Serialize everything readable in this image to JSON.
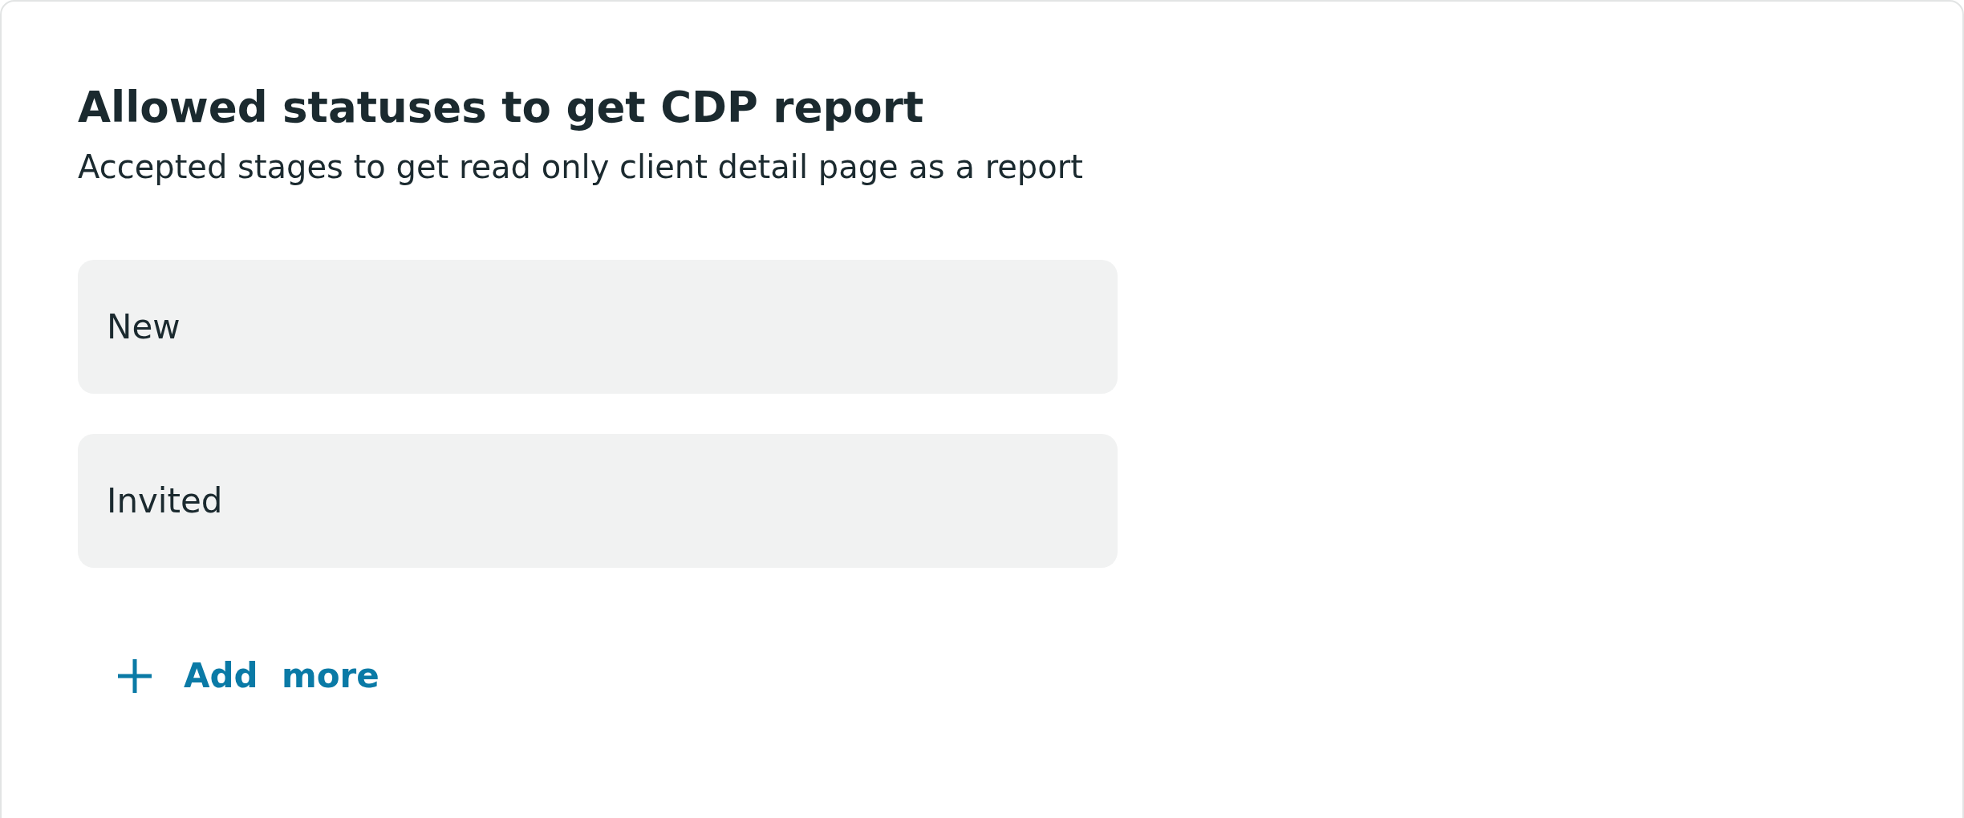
{
  "title": "Allowed statuses to get CDP report",
  "subtitle": "Accepted stages to get read only client detail page as a report",
  "statuses": [
    {
      "label": "New"
    },
    {
      "label": "Invited"
    }
  ],
  "add_button": {
    "label": "Add  more"
  }
}
